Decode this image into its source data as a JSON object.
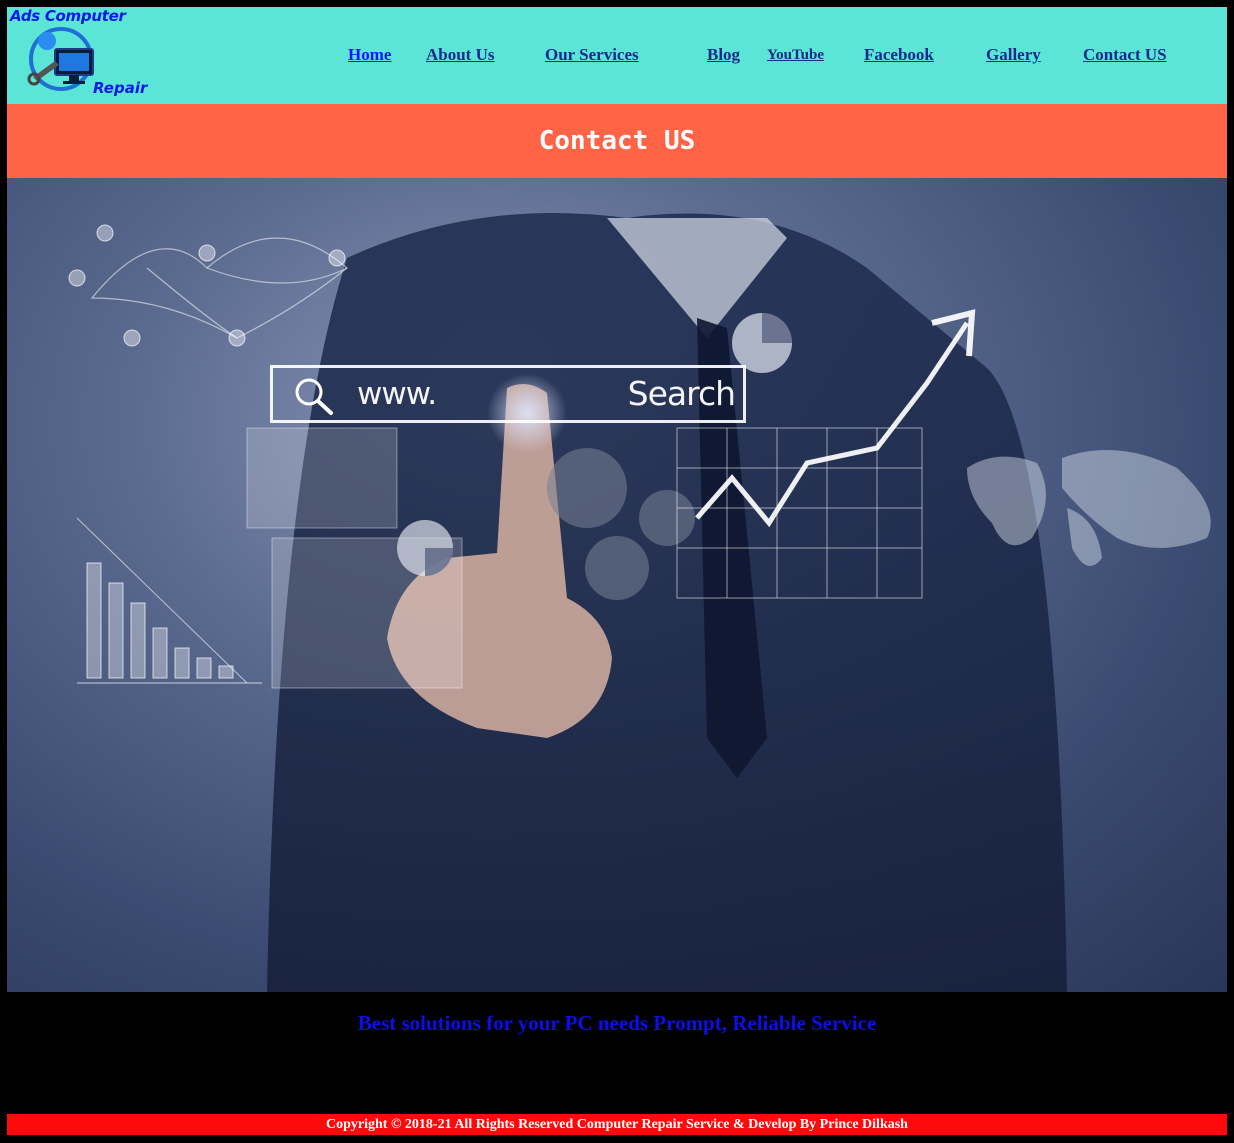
{
  "brand": {
    "name_top": "Ads Computer",
    "name_bottom": "Repair",
    "logo_icon": "computer-repair-logo-icon"
  },
  "nav": {
    "home": "Home",
    "about": "About Us",
    "services": "Our Services",
    "blog": "Blog",
    "youtube": "YouTube",
    "facebook": "Facebook",
    "gallery": "Gallery",
    "contact": "Contact US"
  },
  "page": {
    "title": "Contact US"
  },
  "hero": {
    "search_prefix": "www.",
    "search_label": "Search",
    "image_description_icon": "businessman-touch-screen-analytics-image"
  },
  "tagline": "Best solutions for your PC needs Prompt, Reliable Service",
  "footer": {
    "copyright": "Copyright © 2018-21 All Rights Reserved Computer Repair Service & Develop By Prince Dilkash"
  },
  "colors": {
    "header_bg": "#5ae5d6",
    "title_bg": "#ff6446",
    "footer_bg": "#ff0a0a",
    "page_bg": "#000000",
    "link": "#1a2b8a",
    "link_active": "#0b18ff",
    "tagline": "#0b10e6"
  }
}
